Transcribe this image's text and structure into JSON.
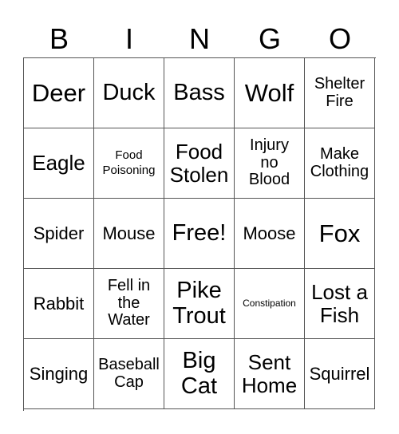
{
  "header": {
    "letters": [
      "B",
      "I",
      "N",
      "G",
      "O"
    ]
  },
  "grid": {
    "rows": [
      [
        "Deer",
        "Duck",
        "Bass",
        "Wolf",
        "Shelter\nFire"
      ],
      [
        "Eagle",
        "Food\nPoisoning",
        "Food\nStolen",
        "Injury\nno\nBlood",
        "Make\nClothing"
      ],
      [
        "Spider",
        "Mouse",
        "Free!",
        "Moose",
        "Fox"
      ],
      [
        "Rabbit",
        "Fell in\nthe\nWater",
        "Pike\nTrout",
        "Constipation",
        "Lost a\nFish"
      ],
      [
        "Singing",
        "Baseball\nCap",
        "Big\nCat",
        "Sent\nHome",
        "Squirrel"
      ]
    ],
    "free_space": "Free!"
  }
}
